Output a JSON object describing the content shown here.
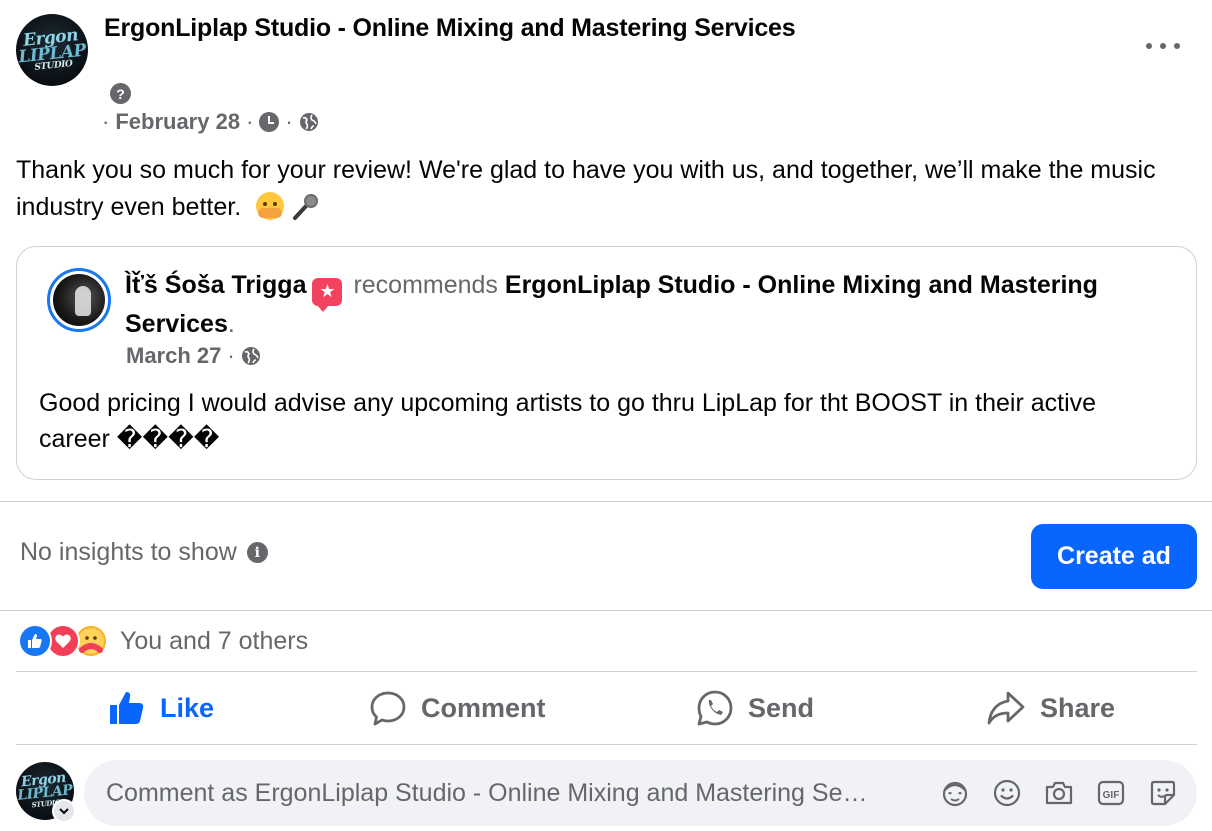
{
  "post": {
    "page_name": "ErgonLiplap Studio - Online Mixing and Mastering Services",
    "avatar_logo": {
      "line1": "Ergon",
      "line2": "LIPLAP",
      "line3": "STUDIO"
    },
    "meta_prefix": "·",
    "date": "February 28",
    "meta_sep": "·",
    "help_glyph": "?",
    "text": "Thank you so much for your review! We're glad to have you with us, and together, we’ll make the music industry even better.",
    "icons": [
      "help-icon",
      "clock-icon",
      "globe-icon",
      "more-icon",
      "hugging-emoji",
      "microphone-emoji"
    ]
  },
  "shared_review": {
    "reviewer_name": "Ìť̌š Śoša Trigga",
    "recommends_text": "recommends",
    "page_name": "ErgonLiplap Studio - Online Mixing and Mastering Services",
    "period": ".",
    "date": "March 27",
    "meta_sep": "·",
    "text": "Good pricing I would advise any upcoming artists to go thru LipLap for tht BOOST in their active career ����",
    "icons": [
      "recommend-icon",
      "globe-icon"
    ]
  },
  "insights": {
    "text": "No insights to show",
    "info_glyph": "i",
    "create_ad_label": "Create ad"
  },
  "reactions": {
    "types": [
      "like",
      "love",
      "care"
    ],
    "summary": "You and 7 others"
  },
  "actions": {
    "like": "Like",
    "comment": "Comment",
    "send": "Send",
    "share": "Share"
  },
  "composer": {
    "placeholder": "Comment as ErgonLiplap Studio - Online Mixing and Mastering Se…",
    "tools": [
      "avatar-sticker-icon",
      "emoji-icon",
      "camera-icon",
      "gif-icon",
      "sticker-icon"
    ],
    "gif_label": "GIF"
  },
  "colors": {
    "accent": "#0866ff",
    "secondary_text": "#65676b",
    "like_blue": "#1877f2",
    "love_red": "#f33e58",
    "care_yellow": "#f7b125",
    "recommend_pink": "#f3425f"
  }
}
